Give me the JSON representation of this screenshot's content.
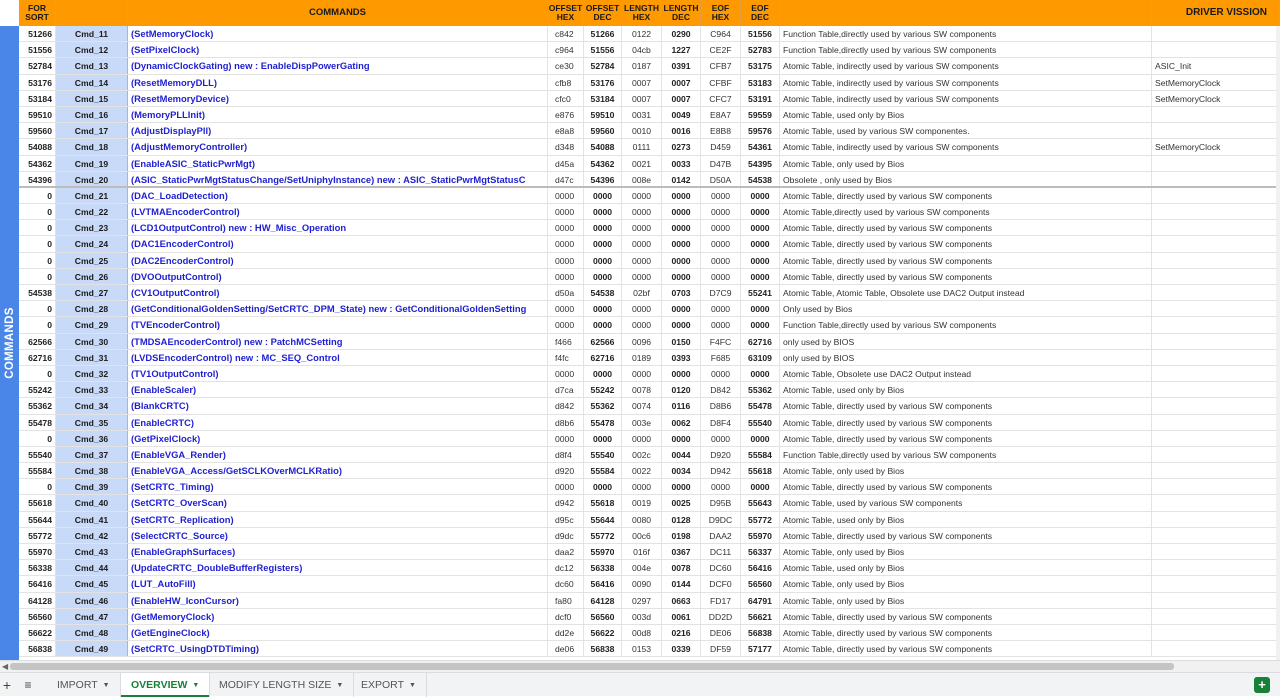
{
  "headers": {
    "sort": [
      "FOR",
      "SORT"
    ],
    "commands": "COMMANDS",
    "offset_hex": [
      "OFFSET",
      "HEX"
    ],
    "offset_dec": [
      "OFFSET",
      "DEC"
    ],
    "length_hex": [
      "LENGTH",
      "HEX"
    ],
    "length_dec": [
      "LENGTH",
      "DEC"
    ],
    "eof_hex": [
      "EOF",
      "HEX"
    ],
    "eof_dec": [
      "EOF",
      "DEC"
    ],
    "driver": "DRIVER VISSION"
  },
  "side_label": "COMMANDS",
  "rows": [
    {
      "sort": "51266",
      "id": "Cmd_11",
      "name": "(SetMemoryClock)",
      "ohex": "c842",
      "odec": "51266",
      "lhex": "0122",
      "ldec": "0290",
      "ehex": "C964",
      "edec": "51556",
      "desc": "Function Table,directly used by various SW components",
      "drv": ""
    },
    {
      "sort": "51556",
      "id": "Cmd_12",
      "name": "(SetPixelClock)",
      "ohex": "c964",
      "odec": "51556",
      "lhex": "04cb",
      "ldec": "1227",
      "ehex": "CE2F",
      "edec": "52783",
      "desc": "Function Table,directly used by various SW components",
      "drv": ""
    },
    {
      "sort": "52784",
      "id": "Cmd_13",
      "name": "(DynamicClockGating) new : EnableDispPowerGating",
      "ohex": "ce30",
      "odec": "52784",
      "lhex": "0187",
      "ldec": "0391",
      "ehex": "CFB7",
      "edec": "53175",
      "desc": "Atomic Table,  indirectly used by various SW components",
      "drv": "ASIC_Init"
    },
    {
      "sort": "53176",
      "id": "Cmd_14",
      "name": "(ResetMemoryDLL)",
      "ohex": "cfb8",
      "odec": "53176",
      "lhex": "0007",
      "ldec": "0007",
      "ehex": "CFBF",
      "edec": "53183",
      "desc": "Atomic Table,  indirectly used by various SW components",
      "drv": "SetMemoryClock"
    },
    {
      "sort": "53184",
      "id": "Cmd_15",
      "name": "(ResetMemoryDevice)",
      "ohex": "cfc0",
      "odec": "53184",
      "lhex": "0007",
      "ldec": "0007",
      "ehex": "CFC7",
      "edec": "53191",
      "desc": "Atomic Table,  indirectly used by various SW components",
      "drv": "SetMemoryClock"
    },
    {
      "sort": "59510",
      "id": "Cmd_16",
      "name": "(MemoryPLLInit)",
      "ohex": "e876",
      "odec": "59510",
      "lhex": "0031",
      "ldec": "0049",
      "ehex": "E8A7",
      "edec": "59559",
      "desc": "Atomic Table,  used only by Bios",
      "drv": ""
    },
    {
      "sort": "59560",
      "id": "Cmd_17",
      "name": "(AdjustDisplayPll)",
      "ohex": "e8a8",
      "odec": "59560",
      "lhex": "0010",
      "ldec": "0016",
      "ehex": "E8B8",
      "edec": "59576",
      "desc": "Atomic Table,  used by various SW componentes.",
      "drv": ""
    },
    {
      "sort": "54088",
      "id": "Cmd_18",
      "name": "(AdjustMemoryController)",
      "ohex": "d348",
      "odec": "54088",
      "lhex": "0111",
      "ldec": "0273",
      "ehex": "D459",
      "edec": "54361",
      "desc": "Atomic Table,  indirectly used by various SW components",
      "drv": "SetMemoryClock"
    },
    {
      "sort": "54362",
      "id": "Cmd_19",
      "name": "(EnableASIC_StaticPwrMgt)",
      "ohex": "d45a",
      "odec": "54362",
      "lhex": "0021",
      "ldec": "0033",
      "ehex": "D47B",
      "edec": "54395",
      "desc": "Atomic Table,  only used by Bios",
      "drv": ""
    },
    {
      "sort": "54396",
      "id": "Cmd_20",
      "name": "(ASIC_StaticPwrMgtStatusChange/SetUniphyInstance) new :  ASIC_StaticPwrMgtStatusC",
      "ohex": "d47c",
      "odec": "54396",
      "lhex": "008e",
      "ldec": "0142",
      "ehex": "D50A",
      "edec": "54538",
      "desc": "Obsolete ,    only used by Bios",
      "drv": ""
    },
    {
      "sort": "0",
      "id": "Cmd_21",
      "name": "(DAC_LoadDetection)",
      "ohex": "0000",
      "odec": "0000",
      "lhex": "0000",
      "ldec": "0000",
      "ehex": "0000",
      "edec": "0000",
      "desc": "Atomic Table,  directly used by various SW components",
      "drv": ""
    },
    {
      "sort": "0",
      "id": "Cmd_22",
      "name": "(LVTMAEncoderControl)",
      "ohex": "0000",
      "odec": "0000",
      "lhex": "0000",
      "ldec": "0000",
      "ehex": "0000",
      "edec": "0000",
      "desc": "Atomic Table,directly used by various SW components",
      "drv": ""
    },
    {
      "sort": "0",
      "id": "Cmd_23",
      "name": "(LCD1OutputControl) new : HW_Misc_Operation",
      "ohex": "0000",
      "odec": "0000",
      "lhex": "0000",
      "ldec": "0000",
      "ehex": "0000",
      "edec": "0000",
      "desc": "Atomic Table,  directly used by various SW components",
      "drv": ""
    },
    {
      "sort": "0",
      "id": "Cmd_24",
      "name": "(DAC1EncoderControl)",
      "ohex": "0000",
      "odec": "0000",
      "lhex": "0000",
      "ldec": "0000",
      "ehex": "0000",
      "edec": "0000",
      "desc": "Atomic Table,  directly used by various SW components",
      "drv": ""
    },
    {
      "sort": "0",
      "id": "Cmd_25",
      "name": "(DAC2EncoderControl)",
      "ohex": "0000",
      "odec": "0000",
      "lhex": "0000",
      "ldec": "0000",
      "ehex": "0000",
      "edec": "0000",
      "desc": "Atomic Table,  directly used by various SW components",
      "drv": ""
    },
    {
      "sort": "0",
      "id": "Cmd_26",
      "name": "(DVOOutputControl)",
      "ohex": "0000",
      "odec": "0000",
      "lhex": "0000",
      "ldec": "0000",
      "ehex": "0000",
      "edec": "0000",
      "desc": "Atomic Table,  directly used by various SW components",
      "drv": ""
    },
    {
      "sort": "54538",
      "id": "Cmd_27",
      "name": "(CV1OutputControl)",
      "ohex": "d50a",
      "odec": "54538",
      "lhex": "02bf",
      "ldec": "0703",
      "ehex": "D7C9",
      "edec": "55241",
      "desc": "Atomic Table,  Atomic Table,  Obsolete use DAC2 Output instead",
      "drv": ""
    },
    {
      "sort": "0",
      "id": "Cmd_28",
      "name": "(GetConditionalGoldenSetting/SetCRTC_DPM_State) new :  GetConditionalGoldenSetting",
      "ohex": "0000",
      "odec": "0000",
      "lhex": "0000",
      "ldec": "0000",
      "ehex": "0000",
      "edec": "0000",
      "desc": "Only used by Bios",
      "drv": ""
    },
    {
      "sort": "0",
      "id": "Cmd_29",
      "name": "(TVEncoderControl)",
      "ohex": "0000",
      "odec": "0000",
      "lhex": "0000",
      "ldec": "0000",
      "ehex": "0000",
      "edec": "0000",
      "desc": "Function Table,directly used by various SW components",
      "drv": ""
    },
    {
      "sort": "62566",
      "id": "Cmd_30",
      "name": "(TMDSAEncoderControl) new : PatchMCSetting",
      "ohex": "f466",
      "odec": "62566",
      "lhex": "0096",
      "ldec": "0150",
      "ehex": "F4FC",
      "edec": "62716",
      "desc": "only used by BIOS",
      "drv": ""
    },
    {
      "sort": "62716",
      "id": "Cmd_31",
      "name": "(LVDSEncoderControl) new : MC_SEQ_Control",
      "ohex": "f4fc",
      "odec": "62716",
      "lhex": "0189",
      "ldec": "0393",
      "ehex": "F685",
      "edec": "63109",
      "desc": "only used by BIOS",
      "drv": ""
    },
    {
      "sort": "0",
      "id": "Cmd_32",
      "name": "(TV1OutputControl)",
      "ohex": "0000",
      "odec": "0000",
      "lhex": "0000",
      "ldec": "0000",
      "ehex": "0000",
      "edec": "0000",
      "desc": "Atomic Table,  Obsolete  use DAC2 Output instead",
      "drv": ""
    },
    {
      "sort": "55242",
      "id": "Cmd_33",
      "name": "(EnableScaler)",
      "ohex": "d7ca",
      "odec": "55242",
      "lhex": "0078",
      "ldec": "0120",
      "ehex": "D842",
      "edec": "55362",
      "desc": "Atomic Table,  used only by Bios",
      "drv": ""
    },
    {
      "sort": "55362",
      "id": "Cmd_34",
      "name": "(BlankCRTC)",
      "ohex": "d842",
      "odec": "55362",
      "lhex": "0074",
      "ldec": "0116",
      "ehex": "D8B6",
      "edec": "55478",
      "desc": "Atomic Table,  directly used by various SW components",
      "drv": ""
    },
    {
      "sort": "55478",
      "id": "Cmd_35",
      "name": "(EnableCRTC)",
      "ohex": "d8b6",
      "odec": "55478",
      "lhex": "003e",
      "ldec": "0062",
      "ehex": "D8F4",
      "edec": "55540",
      "desc": "Atomic Table,  directly used by various SW components",
      "drv": ""
    },
    {
      "sort": "0",
      "id": "Cmd_36",
      "name": "(GetPixelClock)",
      "ohex": "0000",
      "odec": "0000",
      "lhex": "0000",
      "ldec": "0000",
      "ehex": "0000",
      "edec": "0000",
      "desc": "Atomic Table,  directly used by various SW components",
      "drv": ""
    },
    {
      "sort": "55540",
      "id": "Cmd_37",
      "name": "(EnableVGA_Render)",
      "ohex": "d8f4",
      "odec": "55540",
      "lhex": "002c",
      "ldec": "0044",
      "ehex": "D920",
      "edec": "55584",
      "desc": "Function Table,directly used by various SW components",
      "drv": ""
    },
    {
      "sort": "55584",
      "id": "Cmd_38",
      "name": "(EnableVGA_Access/GetSCLKOverMCLKRatio)",
      "ohex": "d920",
      "odec": "55584",
      "lhex": "0022",
      "ldec": "0034",
      "ehex": "D942",
      "edec": "55618",
      "desc": "Atomic Table,  only used by Bios",
      "drv": ""
    },
    {
      "sort": "0",
      "id": "Cmd_39",
      "name": "(SetCRTC_Timing)",
      "ohex": "0000",
      "odec": "0000",
      "lhex": "0000",
      "ldec": "0000",
      "ehex": "0000",
      "edec": "0000",
      "desc": "Atomic Table,  directly used by various SW components",
      "drv": ""
    },
    {
      "sort": "55618",
      "id": "Cmd_40",
      "name": "(SetCRTC_OverScan)",
      "ohex": "d942",
      "odec": "55618",
      "lhex": "0019",
      "ldec": "0025",
      "ehex": "D95B",
      "edec": "55643",
      "desc": "Atomic Table,  used by various SW components",
      "drv": ""
    },
    {
      "sort": "55644",
      "id": "Cmd_41",
      "name": "(SetCRTC_Replication)",
      "ohex": "d95c",
      "odec": "55644",
      "lhex": "0080",
      "ldec": "0128",
      "ehex": "D9DC",
      "edec": "55772",
      "desc": "Atomic Table,  used only by Bios",
      "drv": ""
    },
    {
      "sort": "55772",
      "id": "Cmd_42",
      "name": "(SelectCRTC_Source)",
      "ohex": "d9dc",
      "odec": "55772",
      "lhex": "00c6",
      "ldec": "0198",
      "ehex": "DAA2",
      "edec": "55970",
      "desc": "Atomic Table,  directly used by various SW components",
      "drv": ""
    },
    {
      "sort": "55970",
      "id": "Cmd_43",
      "name": "(EnableGraphSurfaces)",
      "ohex": "daa2",
      "odec": "55970",
      "lhex": "016f",
      "ldec": "0367",
      "ehex": "DC11",
      "edec": "56337",
      "desc": "Atomic Table,  only used by Bios",
      "drv": ""
    },
    {
      "sort": "56338",
      "id": "Cmd_44",
      "name": "(UpdateCRTC_DoubleBufferRegisters)",
      "ohex": "dc12",
      "odec": "56338",
      "lhex": "004e",
      "ldec": "0078",
      "ehex": "DC60",
      "edec": "56416",
      "desc": "Atomic Table,  used only by Bios",
      "drv": ""
    },
    {
      "sort": "56416",
      "id": "Cmd_45",
      "name": "(LUT_AutoFill)",
      "ohex": "dc60",
      "odec": "56416",
      "lhex": "0090",
      "ldec": "0144",
      "ehex": "DCF0",
      "edec": "56560",
      "desc": "Atomic Table,  only used by Bios",
      "drv": ""
    },
    {
      "sort": "64128",
      "id": "Cmd_46",
      "name": "(EnableHW_IconCursor)",
      "ohex": "fa80",
      "odec": "64128",
      "lhex": "0297",
      "ldec": "0663",
      "ehex": "FD17",
      "edec": "64791",
      "desc": "Atomic Table,  only used by Bios",
      "drv": ""
    },
    {
      "sort": "56560",
      "id": "Cmd_47",
      "name": "(GetMemoryClock)",
      "ohex": "dcf0",
      "odec": "56560",
      "lhex": "003d",
      "ldec": "0061",
      "ehex": "DD2D",
      "edec": "56621",
      "desc": "Atomic Table,  directly used by various SW components",
      "drv": ""
    },
    {
      "sort": "56622",
      "id": "Cmd_48",
      "name": "(GetEngineClock)",
      "ohex": "dd2e",
      "odec": "56622",
      "lhex": "00d8",
      "ldec": "0216",
      "ehex": "DE06",
      "edec": "56838",
      "desc": "Atomic Table,  directly used by various SW components",
      "drv": ""
    },
    {
      "sort": "56838",
      "id": "Cmd_49",
      "name": "(SetCRTC_UsingDTDTiming)",
      "ohex": "de06",
      "odec": "56838",
      "lhex": "0153",
      "ldec": "0339",
      "ehex": "DF59",
      "edec": "57177",
      "desc": "Atomic Table,  directly used by various SW components",
      "drv": ""
    }
  ],
  "tabs": [
    {
      "label": "IMPORT",
      "active": false
    },
    {
      "label": "OVERVIEW",
      "active": true
    },
    {
      "label": "MODIFY LENGTH SIZE",
      "active": false
    },
    {
      "label": "EXPORT",
      "active": false
    }
  ],
  "icons": {
    "add": "plus-icon",
    "all_sheets": "list-icon",
    "explore": "explore-icon"
  },
  "colors": {
    "header": "#ff9900",
    "side_strip": "#4a86e8",
    "id_column": "#c9daf8",
    "command_text": "#1f1fd1",
    "active_tab": "#188038"
  }
}
